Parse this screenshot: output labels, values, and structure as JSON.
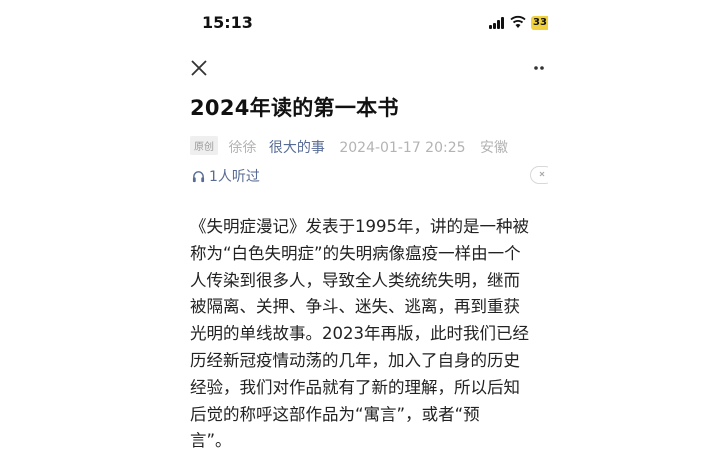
{
  "status_bar": {
    "time": "15:13",
    "battery": "33"
  },
  "article": {
    "title": "2024年读的第一本书",
    "badge": "原创",
    "author": "徐徐",
    "account": "很大的事",
    "datetime": "2024-01-17 20:25",
    "location": "安徽",
    "listen_count": "1人听过",
    "body_lines": [
      "《失明症漫记》发表于1995年，讲的是一种被",
      "称为“白色失明症”的失明病像瘟疫一样由一个",
      "人传染到很多人，导致全人类统统失明，继而",
      "被隔离、关押、争斗、迷失、逃离，再到重获",
      "光明的单线故事。2023年再版，此时我们已经",
      "历经新冠疫情动荡的几年，加入了自身的历史",
      "经验，我们对作品就有了新的理解，所以后知",
      "后觉的称呼这部作品为“寓言”，或者“预",
      "言”。"
    ]
  },
  "icons": {
    "close": "close-icon",
    "more": "more-icon",
    "headphones": "headphones-icon",
    "listen_close": "close-icon"
  }
}
